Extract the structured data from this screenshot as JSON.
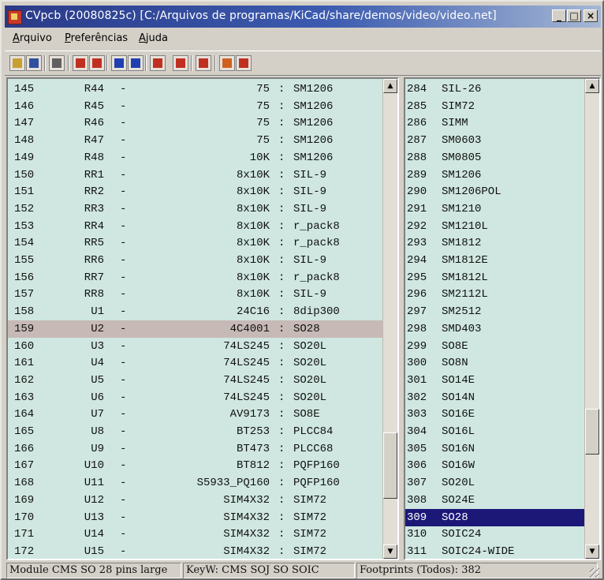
{
  "window": {
    "title": "CVpcb (20080825c) [C:/Arquivos de programas/KiCad/share/demos/video/video.net]",
    "controls": [
      "_",
      "□",
      "×"
    ]
  },
  "menu": [
    {
      "accel": "A",
      "rest": "rquivo"
    },
    {
      "accel": "P",
      "rest": "referências"
    },
    {
      "accel": "A",
      "rest": "juda"
    }
  ],
  "toolbar": {
    "buttons": [
      {
        "name": "open-icon",
        "color": "#c8a030"
      },
      {
        "name": "save-icon",
        "color": "#3050a0"
      },
      {
        "name": "config-icon",
        "color": "#606060"
      },
      {
        "name": "module-list-icon",
        "color": "#c03020"
      },
      {
        "name": "view-module-icon",
        "color": "#c03020"
      },
      {
        "name": "previous-arrow-icon",
        "color": "#2040b0"
      },
      {
        "name": "next-arrow-icon",
        "color": "#2040b0"
      },
      {
        "name": "auto-associate-icon",
        "color": "#c03020"
      },
      {
        "name": "delete-associations-icon",
        "color": "#c03020"
      },
      {
        "name": "create-export-icon",
        "color": "#c03020"
      },
      {
        "name": "filter-footprints-icon",
        "color": "#d06020"
      },
      {
        "name": "show-all-footprints-icon",
        "color": "#c03020"
      }
    ]
  },
  "components": [
    {
      "n": "145",
      "ref": "R44",
      "value": "75",
      "footprint": "SM1206"
    },
    {
      "n": "146",
      "ref": "R45",
      "value": "75",
      "footprint": "SM1206"
    },
    {
      "n": "147",
      "ref": "R46",
      "value": "75",
      "footprint": "SM1206"
    },
    {
      "n": "148",
      "ref": "R47",
      "value": "75",
      "footprint": "SM1206"
    },
    {
      "n": "149",
      "ref": "R48",
      "value": "10K",
      "footprint": "SM1206"
    },
    {
      "n": "150",
      "ref": "RR1",
      "value": "8x10K",
      "footprint": "SIL-9"
    },
    {
      "n": "151",
      "ref": "RR2",
      "value": "8x10K",
      "footprint": "SIL-9"
    },
    {
      "n": "152",
      "ref": "RR3",
      "value": "8x10K",
      "footprint": "SIL-9"
    },
    {
      "n": "153",
      "ref": "RR4",
      "value": "8x10K",
      "footprint": "r_pack8"
    },
    {
      "n": "154",
      "ref": "RR5",
      "value": "8x10K",
      "footprint": "r_pack8"
    },
    {
      "n": "155",
      "ref": "RR6",
      "value": "8x10K",
      "footprint": "SIL-9"
    },
    {
      "n": "156",
      "ref": "RR7",
      "value": "8x10K",
      "footprint": "r_pack8"
    },
    {
      "n": "157",
      "ref": "RR8",
      "value": "8x10K",
      "footprint": "SIL-9"
    },
    {
      "n": "158",
      "ref": "U1",
      "value": "24C16",
      "footprint": "8dip300"
    },
    {
      "n": "159",
      "ref": "U2",
      "value": "4C4001",
      "footprint": "SO28",
      "selected": true
    },
    {
      "n": "160",
      "ref": "U3",
      "value": "74LS245",
      "footprint": "SO20L"
    },
    {
      "n": "161",
      "ref": "U4",
      "value": "74LS245",
      "footprint": "SO20L"
    },
    {
      "n": "162",
      "ref": "U5",
      "value": "74LS245",
      "footprint": "SO20L"
    },
    {
      "n": "163",
      "ref": "U6",
      "value": "74LS245",
      "footprint": "SO20L"
    },
    {
      "n": "164",
      "ref": "U7",
      "value": "AV9173",
      "footprint": "SO8E"
    },
    {
      "n": "165",
      "ref": "U8",
      "value": "BT253",
      "footprint": "PLCC84"
    },
    {
      "n": "166",
      "ref": "U9",
      "value": "BT473",
      "footprint": "PLCC68"
    },
    {
      "n": "167",
      "ref": "U10",
      "value": "BT812",
      "footprint": "PQFP160"
    },
    {
      "n": "168",
      "ref": "U11",
      "value": "S5933_PQ160",
      "footprint": "PQFP160"
    },
    {
      "n": "169",
      "ref": "U12",
      "value": "SIM4X32",
      "footprint": "SIM72"
    },
    {
      "n": "170",
      "ref": "U13",
      "value": "SIM4X32",
      "footprint": "SIM72"
    },
    {
      "n": "171",
      "ref": "U14",
      "value": "SIM4X32",
      "footprint": "SIM72"
    },
    {
      "n": "172",
      "ref": "U15",
      "value": "SIM4X32",
      "footprint": "SIM72"
    }
  ],
  "footprints": [
    {
      "n": "284",
      "name": "SIL-26"
    },
    {
      "n": "285",
      "name": "SIM72"
    },
    {
      "n": "286",
      "name": "SIMM"
    },
    {
      "n": "287",
      "name": "SM0603"
    },
    {
      "n": "288",
      "name": "SM0805"
    },
    {
      "n": "289",
      "name": "SM1206"
    },
    {
      "n": "290",
      "name": "SM1206POL"
    },
    {
      "n": "291",
      "name": "SM1210"
    },
    {
      "n": "292",
      "name": "SM1210L"
    },
    {
      "n": "293",
      "name": "SM1812"
    },
    {
      "n": "294",
      "name": "SM1812E"
    },
    {
      "n": "295",
      "name": "SM1812L"
    },
    {
      "n": "296",
      "name": "SM2112L"
    },
    {
      "n": "297",
      "name": "SM2512"
    },
    {
      "n": "298",
      "name": "SMD403"
    },
    {
      "n": "299",
      "name": "SO8E"
    },
    {
      "n": "300",
      "name": "SO8N"
    },
    {
      "n": "301",
      "name": "SO14E"
    },
    {
      "n": "302",
      "name": "SO14N"
    },
    {
      "n": "303",
      "name": "SO16E"
    },
    {
      "n": "304",
      "name": "SO16L"
    },
    {
      "n": "305",
      "name": "SO16N"
    },
    {
      "n": "306",
      "name": "SO16W"
    },
    {
      "n": "307",
      "name": "SO20L"
    },
    {
      "n": "308",
      "name": "SO24E"
    },
    {
      "n": "309",
      "name": "SO28",
      "selected": true
    },
    {
      "n": "310",
      "name": "SOIC24"
    },
    {
      "n": "311",
      "name": "SOIC24-WIDE"
    }
  ],
  "scroll": {
    "left": {
      "up": "▲",
      "down": "▼"
    },
    "right": {
      "up": "▲",
      "down": "▼"
    }
  },
  "status": {
    "module": "Module CMS SO 28 pins large",
    "keyw": "KeyW: CMS SOJ SO SOIC",
    "footprints": "Footprints (Todos): 382"
  },
  "colors": {
    "list_bg": "#cfe7e0",
    "selected_gray": "#c7b9b6",
    "selected_blue": "#1c1878"
  }
}
